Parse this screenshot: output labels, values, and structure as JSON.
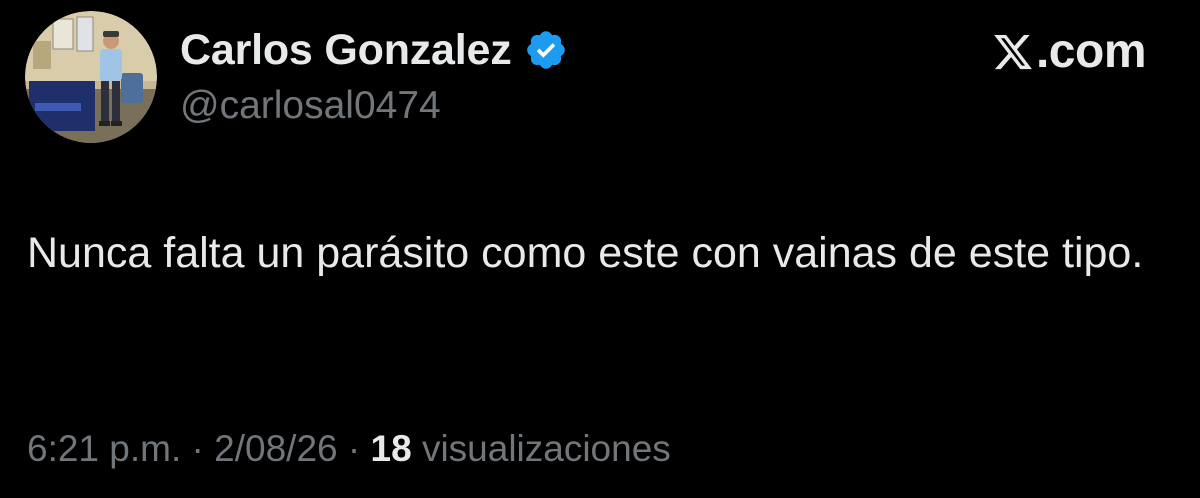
{
  "author": {
    "display_name": "Carlos Gonzalez",
    "handle": "@carlosal0474",
    "verified": true,
    "verified_icon": "verified-badge-icon",
    "verified_color": "#1d9bf0",
    "avatar_alt": "profile photo"
  },
  "brand": {
    "icon": "x-logo-icon",
    "text": ".com"
  },
  "tweet": {
    "text": "Nunca falta un parásito como este con vainas de este tipo."
  },
  "meta": {
    "time": "6:21 p.m.",
    "separator": "·",
    "date": "2/08/26",
    "views_count": "18",
    "views_label": "visualizaciones"
  },
  "colors": {
    "background": "#000000",
    "primary_text": "#e7e9ea",
    "secondary_text": "#71767b",
    "accent": "#1d9bf0"
  }
}
